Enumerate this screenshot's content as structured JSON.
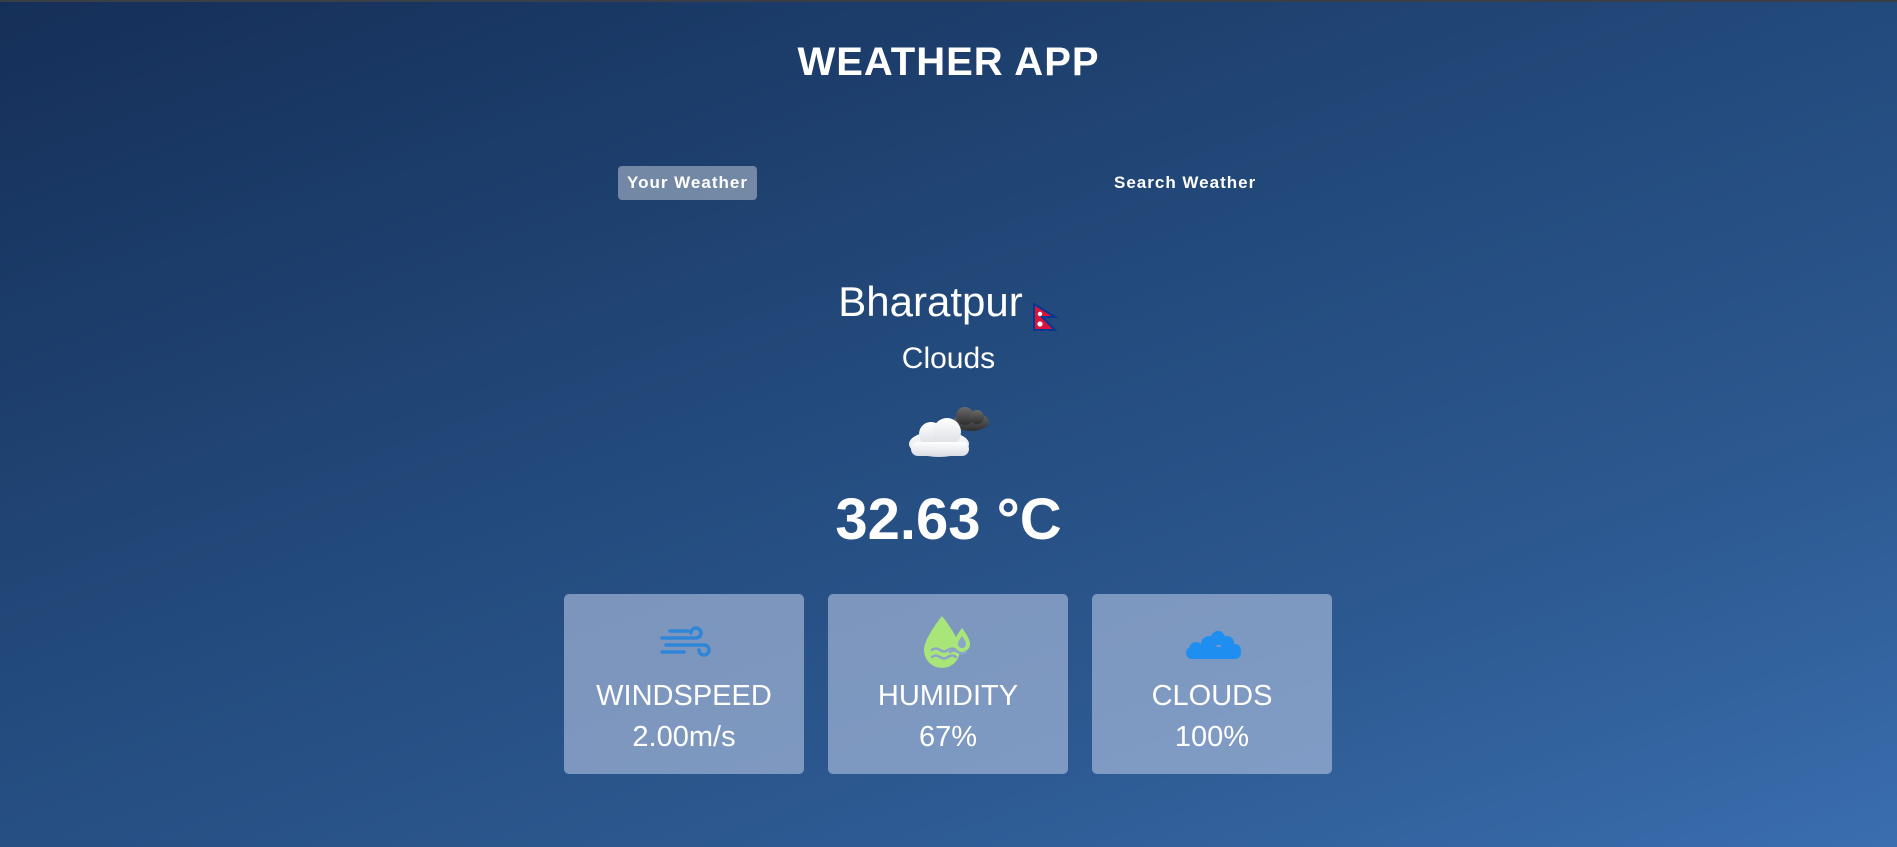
{
  "app": {
    "title": "WEATHER APP"
  },
  "tabs": [
    {
      "label": "Your Weather",
      "active": true
    },
    {
      "label": "Search Weather",
      "active": false
    }
  ],
  "weather": {
    "city": "Bharatpur",
    "country_flag_icon": "nepal-flag-icon",
    "condition": "Clouds",
    "condition_icon": "cloud-with-sun-icon",
    "temperature": "32.63 °C"
  },
  "stats": [
    {
      "icon": "wind-icon",
      "label": "WINDSPEED",
      "value": "2.00m/s",
      "icon_color": "#2f86d9"
    },
    {
      "icon": "humidity-drops-icon",
      "label": "HUMIDITY",
      "value": "67%",
      "icon_color": "#a9e67a"
    },
    {
      "icon": "clouds-icon",
      "label": "CLOUDS",
      "value": "100%",
      "icon_color": "#1e8ff0"
    }
  ],
  "colors": {
    "background_start": "#152f58",
    "background_end": "#3a6eaf",
    "card_background": "#b6c4e2",
    "text": "#ffffff"
  }
}
